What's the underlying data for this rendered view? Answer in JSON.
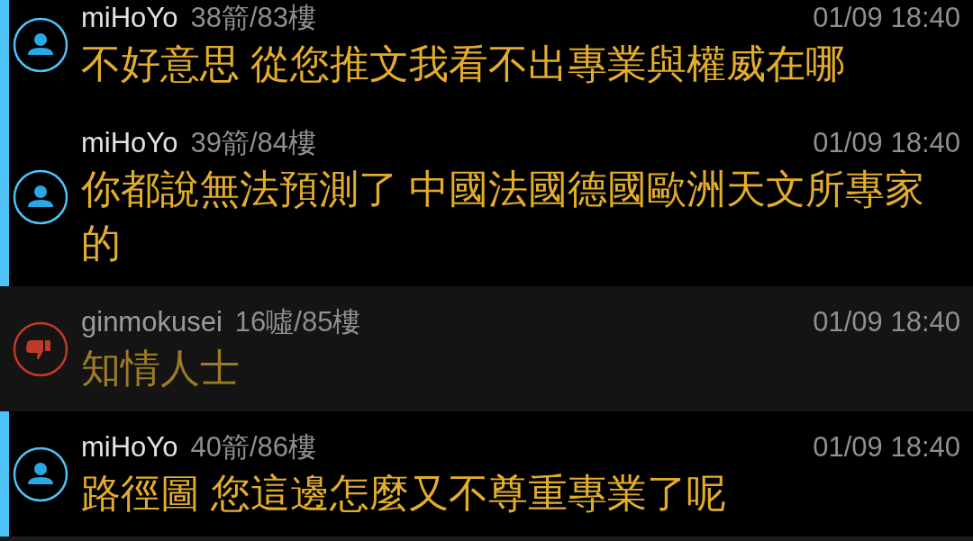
{
  "comments": [
    {
      "kind": "author",
      "user": "miHoYo",
      "count": "38箭/83樓",
      "time": "01/09 18:40",
      "text": "不好意思 從您推文我看不出專業與權威在哪"
    },
    {
      "kind": "author",
      "user": "miHoYo",
      "count": "39箭/84樓",
      "time": "01/09 18:40",
      "text": "你都說無法預測了 中國法國德國歐洲天文所專家的"
    },
    {
      "kind": "boo",
      "user": "ginmokusei",
      "count": "16噓/85樓",
      "time": "01/09 18:40",
      "text": "知情人士"
    },
    {
      "kind": "author",
      "user": "miHoYo",
      "count": "40箭/86樓",
      "time": "01/09 18:40",
      "text": "路徑圖 您這邊怎麼又不尊重專業了呢"
    }
  ]
}
